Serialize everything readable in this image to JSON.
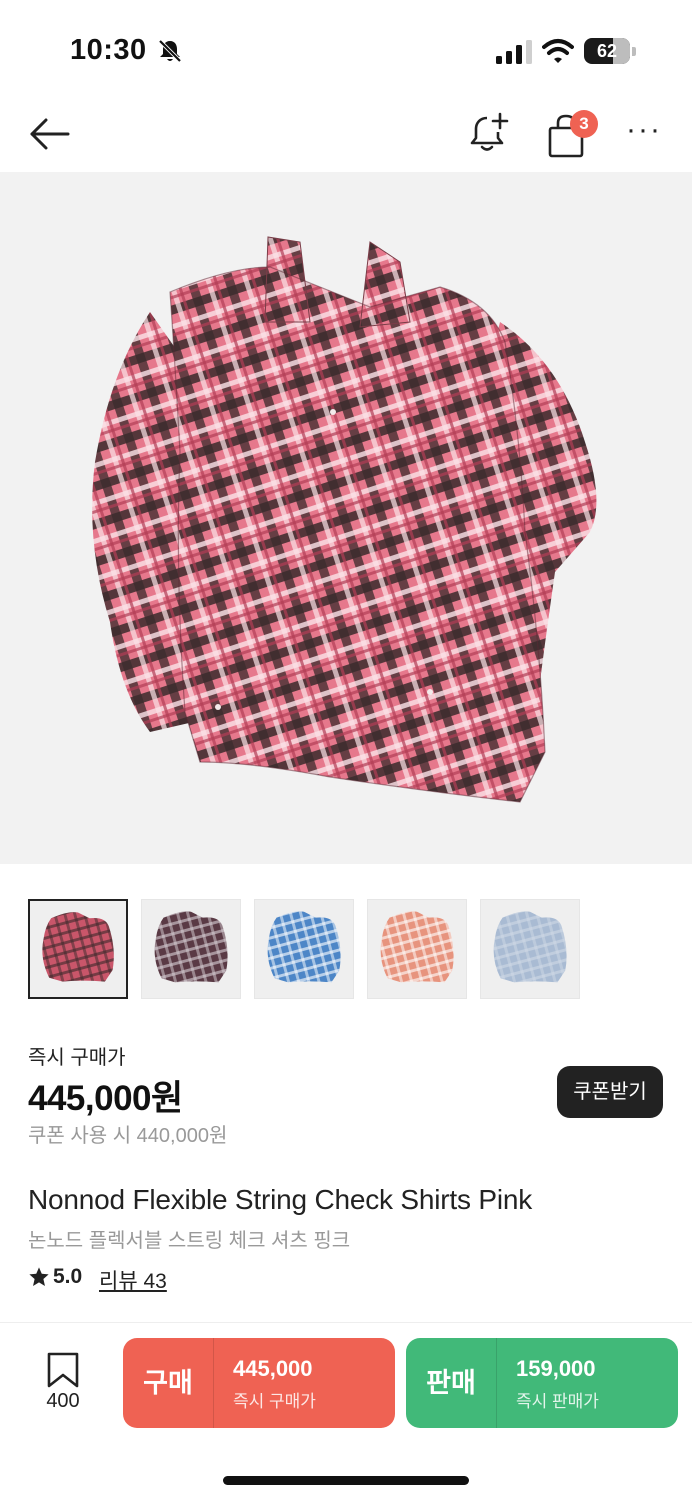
{
  "status_bar": {
    "time": "10:30",
    "battery": "62",
    "battery_level": 0.62
  },
  "nav": {
    "cart_count": "3"
  },
  "images": {
    "thumbnails": [
      {
        "name": "thumb-pink",
        "color": "#c9566a",
        "accent": "#3c2a2c",
        "active": true
      },
      {
        "name": "thumb-black",
        "color": "#5a3a45",
        "accent": "#d8d0d6",
        "active": false
      },
      {
        "name": "thumb-blue",
        "color": "#4d86c7",
        "accent": "#ffffff",
        "active": false
      },
      {
        "name": "thumb-orange",
        "color": "#e7947e",
        "accent": "#ffffff",
        "active": false
      },
      {
        "name": "thumb-lightblue",
        "color": "#a9bbd3",
        "accent": "#cfd9e6",
        "active": false
      }
    ]
  },
  "price": {
    "label": "즉시 구매가",
    "amount": "445,000원",
    "coupon_price": "쿠폰 사용 시 440,000원",
    "coupon_button": "쿠폰받기"
  },
  "product": {
    "title": "Nonnod Flexible String Check Shirts Pink",
    "subtitle": "논노드 플렉서블 스트링 체크 셔츠 핑크",
    "rating": "5.0",
    "review_link": "리뷰 43"
  },
  "actions": {
    "bookmark_count": "400",
    "buy": {
      "label": "구매",
      "price": "445,000",
      "sub": "즉시 구매가"
    },
    "sell": {
      "label": "판매",
      "price": "159,000",
      "sub": "즉시 판매가"
    }
  },
  "colors": {
    "buy": "#ef6253",
    "sell": "#41b979",
    "badge": "#ef6253",
    "shirt_pink": "#d9627a",
    "shirt_dark": "#3b2a2c"
  }
}
